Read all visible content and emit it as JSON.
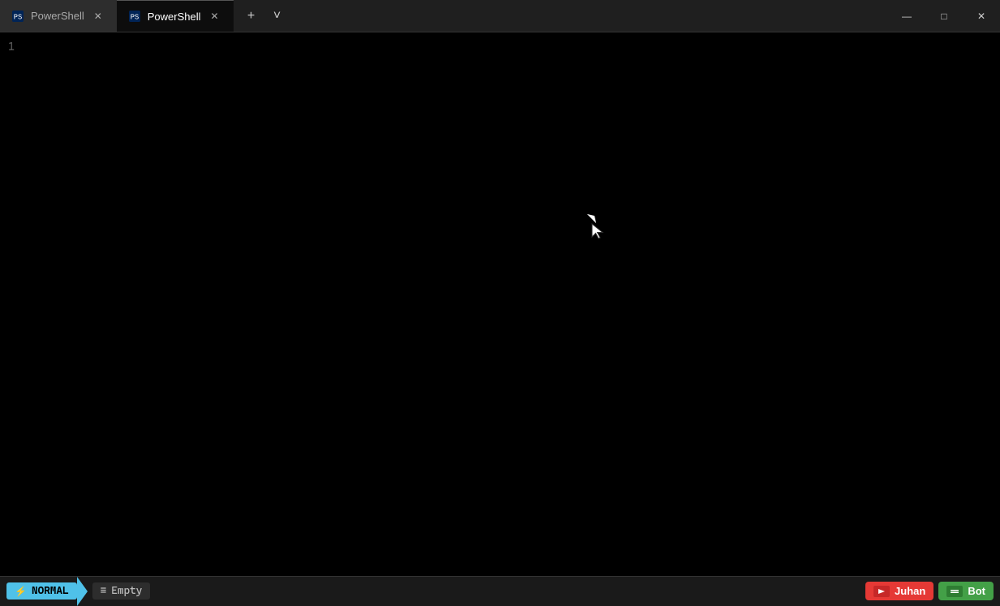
{
  "titlebar": {
    "tabs": [
      {
        "id": "tab1",
        "label": "PowerShell",
        "active": false,
        "icon": "powershell-icon"
      },
      {
        "id": "tab2",
        "label": "PowerShell",
        "active": true,
        "icon": "powershell-icon"
      }
    ],
    "add_tab_label": "+",
    "dropdown_label": "˅"
  },
  "window_controls": {
    "minimize": "—",
    "maximize": "□",
    "close": "✕"
  },
  "terminal": {
    "background": "#000000",
    "line_number": "1"
  },
  "statusbar": {
    "mode": "NORMAL",
    "mode_icon": "⚡",
    "file_icon": "≡",
    "file_label": "Empty",
    "user_label": "Juhan",
    "bot_label": "Bot",
    "user_icon_text": "▶",
    "bot_icon_text": "≡"
  }
}
